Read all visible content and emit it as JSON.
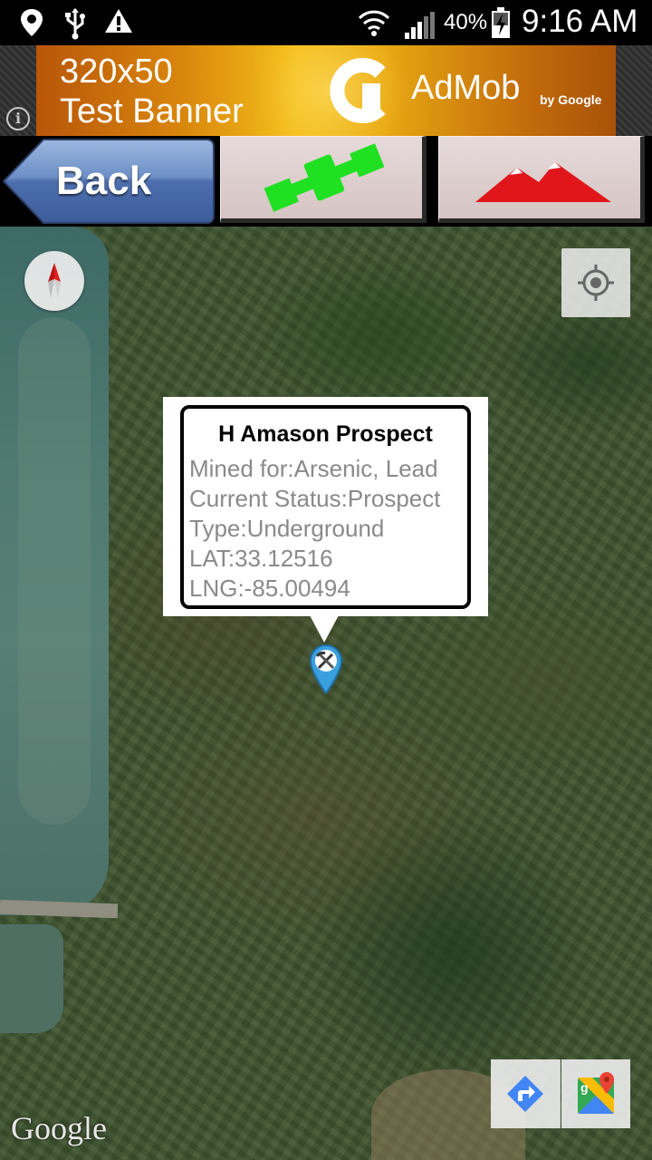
{
  "status_bar": {
    "battery_percent": "40%",
    "time": "9:16 AM",
    "icons": [
      "location-pin-icon",
      "usb-icon",
      "warning-icon",
      "wifi-icon",
      "signal-icon",
      "battery-charging-icon"
    ]
  },
  "ad": {
    "size_text": "320x50",
    "label": "Test Banner",
    "brand": "AdMob",
    "by": "by Google",
    "info_glyph": "i"
  },
  "toolbar": {
    "back_label": "Back",
    "satellite_icon": "satellite-icon",
    "terrain_icon": "mountains-icon",
    "satellite_color": "#1fe021",
    "terrain_color": "#e0161b"
  },
  "info_window": {
    "title": "H Amason Prospect",
    "mined_for": "Mined for:Arsenic, Lead",
    "status": "Current Status:Prospect",
    "type": "Type:Underground",
    "lat": "LAT:33.12516",
    "lng": "LNG:-85.00494"
  },
  "map": {
    "attribution": "Google",
    "marker_icon": "mine-marker-icon",
    "marker_color": "#3aa0dd"
  }
}
